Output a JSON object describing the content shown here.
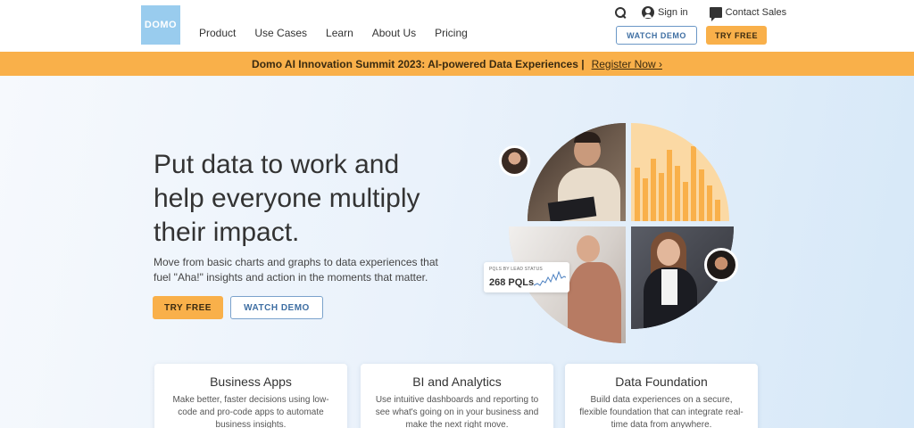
{
  "header": {
    "logo_text": "DOMO",
    "nav": [
      "Product",
      "Use Cases",
      "Learn",
      "About Us",
      "Pricing"
    ],
    "sign_in": "Sign in",
    "contact_sales": "Contact Sales",
    "watch_demo": "WATCH DEMO",
    "try_free": "TRY FREE"
  },
  "banner": {
    "text": "Domo AI Innovation Summit 2023: AI-powered Data Experiences |",
    "link": "Register Now ›"
  },
  "hero": {
    "title": "Put data to work and help everyone multiply their impact.",
    "subtitle": "Move from basic charts and graphs to data experiences that fuel \"Aha!\" insights and action in the moments that matter.",
    "try_free": "TRY FREE",
    "watch_demo": "WATCH DEMO",
    "pql_card": {
      "label": "PQLS BY LEAD STATUS",
      "value": "268 PQLs"
    }
  },
  "cards": [
    {
      "title": "Business Apps",
      "desc": "Make better, faster decisions using low-code and pro-code apps to automate business insights."
    },
    {
      "title": "BI and Analytics",
      "desc": "Use intuitive dashboards and reporting to see what's going on in your business and make the next right move."
    },
    {
      "title": "Data Foundation",
      "desc": "Build data experiences on a secure, flexible foundation that can integrate real-time data from anywhere."
    }
  ],
  "colors": {
    "accent": "#f9b04a",
    "brand_blue": "#99ccee",
    "outline_blue": "#3f6fa3"
  }
}
